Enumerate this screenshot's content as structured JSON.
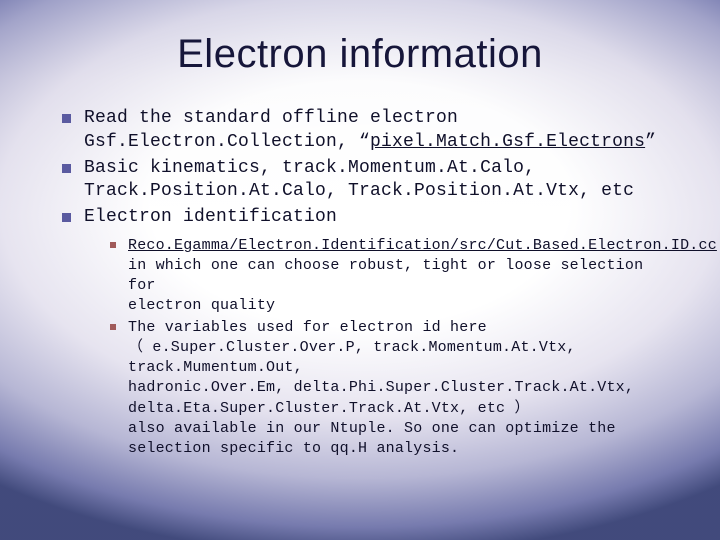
{
  "title": "Electron information",
  "bullets": {
    "b1a": "Read the standard offline electron",
    "b1b_pre": "Gsf.Electron.Collection, “",
    "b1b_link": "pixel.Match.Gsf.Electrons",
    "b1b_post": "”",
    "b2a": "Basic kinematics, track.Momentum.At.Calo,",
    "b2b": "Track.Position.At.Calo, Track.Position.At.Vtx, etc",
    "b3": "Electron identification"
  },
  "sub": {
    "s1_link": "Reco.Egamma/Electron.Identification/src/Cut.Based.Electron.ID.cc",
    "s1_l2": "in which one can choose robust, tight or loose selection for",
    "s1_l3": "electron quality",
    "s2_l1": "The variables used for electron id here",
    "s2_paren_open": "（ ",
    "s2_l2": "e.Super.Cluster.Over.P, track.Momentum.At.Vtx, track.Mumentum.Out,",
    "s2_l3": "hadronic.Over.Em, delta.Phi.Super.Cluster.Track.At.Vtx,",
    "s2_l4": "delta.Eta.Super.Cluster.Track.At.Vtx, etc ）",
    "s2_l5": "also available in our Ntuple. So one can optimize the",
    "s2_l6": "selection specific to qq.H analysis."
  }
}
